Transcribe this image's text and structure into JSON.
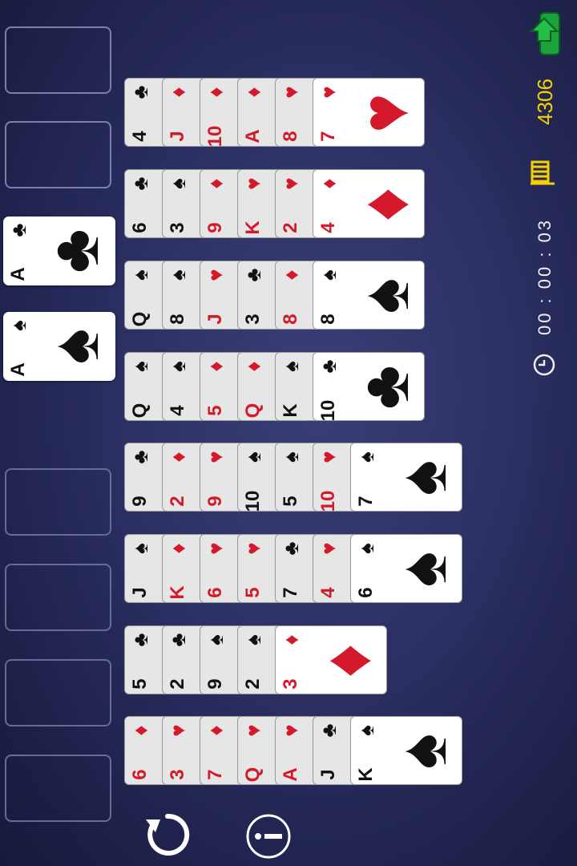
{
  "hud": {
    "score": "4306",
    "timer": "00 : 00 : 03",
    "exit_icon": "exit-door-arrow-icon",
    "moves_icon": "flag-icon",
    "clock_icon": "clock-icon"
  },
  "foundations": [
    {
      "rank": "A",
      "suit": "♣",
      "color": "black"
    },
    {
      "rank": "A",
      "suit": "♠",
      "color": "black"
    }
  ],
  "columns": [
    [
      {
        "r": "4",
        "s": "♣"
      },
      {
        "r": "J",
        "s": "♦"
      },
      {
        "r": "10",
        "s": "♦"
      },
      {
        "r": "A",
        "s": "♦"
      },
      {
        "r": "8",
        "s": "♥"
      },
      {
        "r": "7",
        "s": "♥"
      }
    ],
    [
      {
        "r": "6",
        "s": "♣"
      },
      {
        "r": "3",
        "s": "♠"
      },
      {
        "r": "9",
        "s": "♦"
      },
      {
        "r": "K",
        "s": "♥"
      },
      {
        "r": "2",
        "s": "♥"
      },
      {
        "r": "4",
        "s": "♦"
      }
    ],
    [
      {
        "r": "Q",
        "s": "♠"
      },
      {
        "r": "8",
        "s": "♠"
      },
      {
        "r": "J",
        "s": "♥"
      },
      {
        "r": "3",
        "s": "♣"
      },
      {
        "r": "8",
        "s": "♦"
      },
      {
        "r": "8",
        "s": "♠"
      }
    ],
    [
      {
        "r": "Q",
        "s": "♠"
      },
      {
        "r": "4",
        "s": "♠"
      },
      {
        "r": "5",
        "s": "♦"
      },
      {
        "r": "Q",
        "s": "♦"
      },
      {
        "r": "K",
        "s": "♠"
      },
      {
        "r": "10",
        "s": "♣"
      }
    ],
    [
      {
        "r": "9",
        "s": "♣"
      },
      {
        "r": "2",
        "s": "♦"
      },
      {
        "r": "9",
        "s": "♥"
      },
      {
        "r": "10",
        "s": "♠"
      },
      {
        "r": "5",
        "s": "♠"
      },
      {
        "r": "10",
        "s": "♥"
      },
      {
        "r": "7",
        "s": "♠"
      }
    ],
    [
      {
        "r": "J",
        "s": "♠"
      },
      {
        "r": "K",
        "s": "♦"
      },
      {
        "r": "6",
        "s": "♥"
      },
      {
        "r": "5",
        "s": "♥"
      },
      {
        "r": "7",
        "s": "♣"
      },
      {
        "r": "4",
        "s": "♥"
      },
      {
        "r": "6",
        "s": "♠"
      }
    ],
    [
      {
        "r": "5",
        "s": "♣"
      },
      {
        "r": "2",
        "s": "♣"
      },
      {
        "r": "9",
        "s": "♠"
      },
      {
        "r": "2",
        "s": "♠"
      },
      {
        "r": "3",
        "s": "♦"
      }
    ],
    [
      {
        "r": "6",
        "s": "♦"
      },
      {
        "r": "3",
        "s": "♥"
      },
      {
        "r": "7",
        "s": "♦"
      },
      {
        "r": "Q",
        "s": "♥"
      },
      {
        "r": "A",
        "s": "♥"
      },
      {
        "r": "J",
        "s": "♣"
      },
      {
        "r": "K",
        "s": "♠"
      }
    ]
  ],
  "toolbar": {
    "undo_icon": "undo-icon",
    "info_icon": "info-icon"
  },
  "colors": {
    "score": "#f4d000",
    "exit_green": "#1aa33a",
    "red_suit": "#d3192a"
  }
}
